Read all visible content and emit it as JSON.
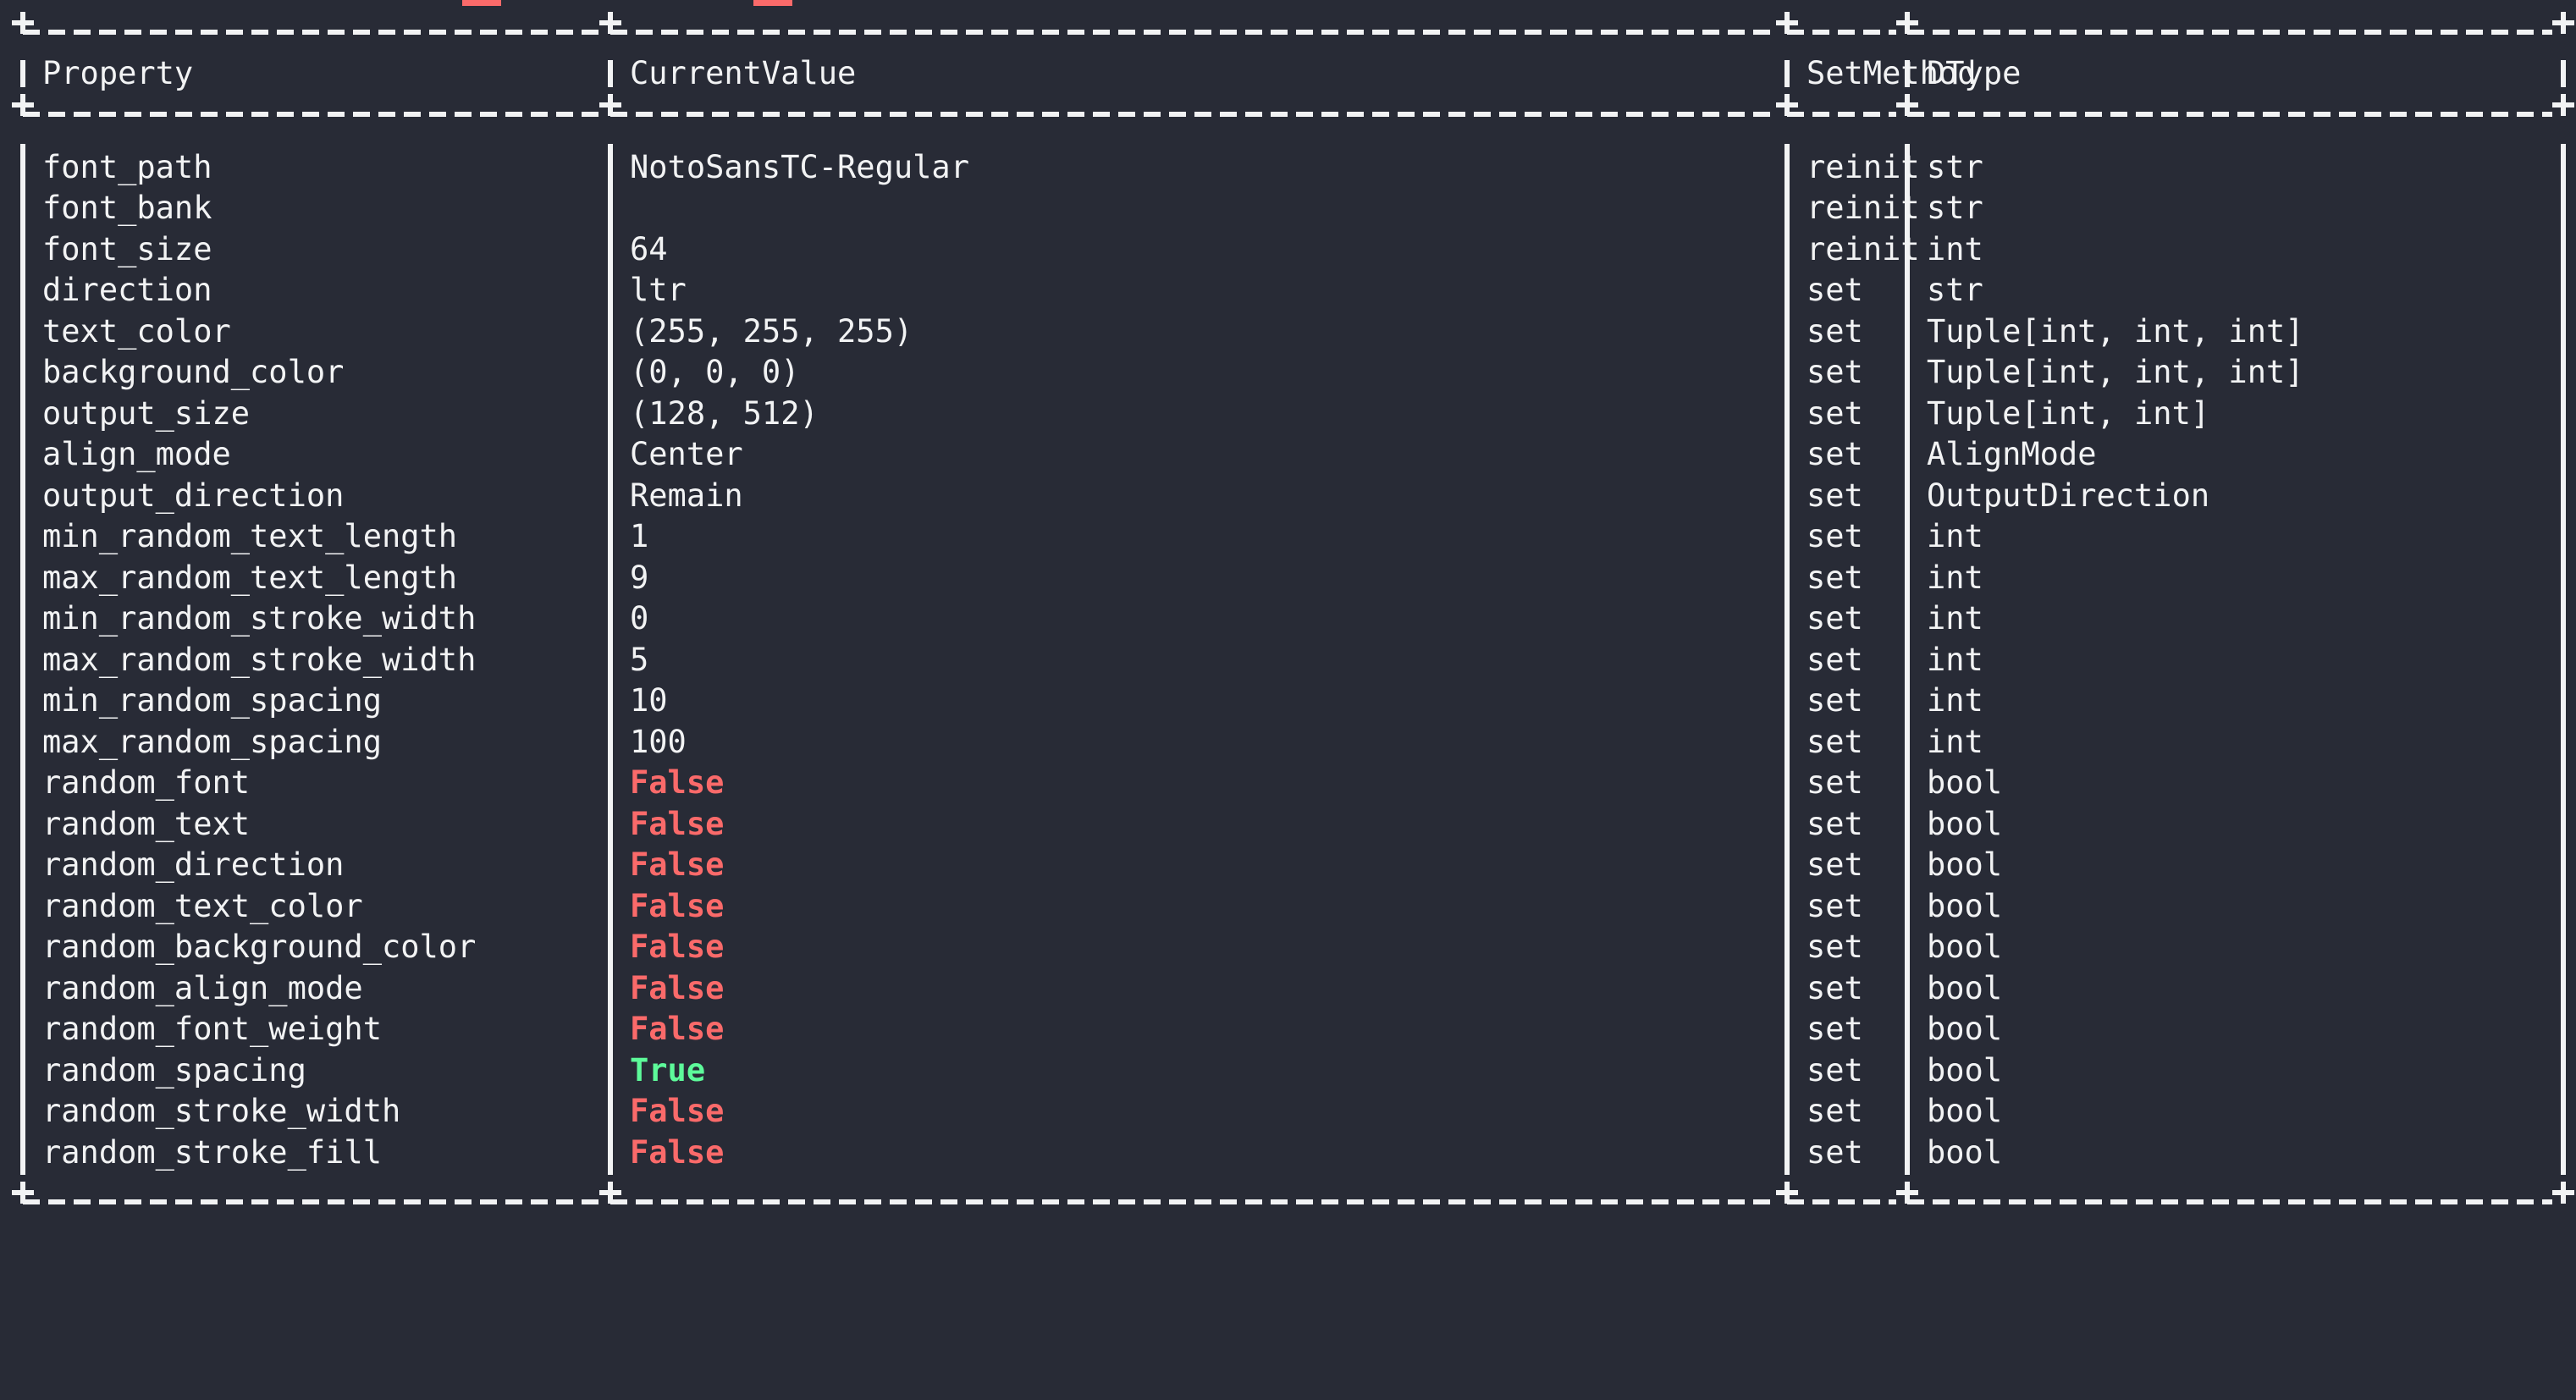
{
  "terminal": {
    "background_color": "#282b36",
    "foreground_color": "#f2f3f4",
    "true_color": "#5dfa9a",
    "false_color": "#fa6a6a"
  },
  "table": {
    "border_style": "ascii-plus-dash-pipe",
    "columns": [
      {
        "key": "property",
        "label": "Property"
      },
      {
        "key": "current_value",
        "label": "CurrentValue"
      },
      {
        "key": "set_method",
        "label": "SetMethod"
      },
      {
        "key": "dtype",
        "label": "DType"
      }
    ],
    "rows": [
      {
        "property": "font_path",
        "current_value": "NotoSansTC-Regular",
        "set_method": "reinit",
        "dtype": "str",
        "value_kind": "text"
      },
      {
        "property": "font_bank",
        "current_value": "",
        "set_method": "reinit",
        "dtype": "str",
        "value_kind": "text"
      },
      {
        "property": "font_size",
        "current_value": "64",
        "set_method": "reinit",
        "dtype": "int",
        "value_kind": "text"
      },
      {
        "property": "direction",
        "current_value": "ltr",
        "set_method": "set",
        "dtype": "str",
        "value_kind": "text"
      },
      {
        "property": "text_color",
        "current_value": "(255, 255, 255)",
        "set_method": "set",
        "dtype": "Tuple[int, int, int]",
        "value_kind": "text"
      },
      {
        "property": "background_color",
        "current_value": "(0, 0, 0)",
        "set_method": "set",
        "dtype": "Tuple[int, int, int]",
        "value_kind": "text"
      },
      {
        "property": "output_size",
        "current_value": "(128, 512)",
        "set_method": "set",
        "dtype": "Tuple[int, int]",
        "value_kind": "text"
      },
      {
        "property": "align_mode",
        "current_value": "Center",
        "set_method": "set",
        "dtype": "AlignMode",
        "value_kind": "text"
      },
      {
        "property": "output_direction",
        "current_value": "Remain",
        "set_method": "set",
        "dtype": "OutputDirection",
        "value_kind": "text"
      },
      {
        "property": "min_random_text_length",
        "current_value": "1",
        "set_method": "set",
        "dtype": "int",
        "value_kind": "text"
      },
      {
        "property": "max_random_text_length",
        "current_value": "9",
        "set_method": "set",
        "dtype": "int",
        "value_kind": "text"
      },
      {
        "property": "min_random_stroke_width",
        "current_value": "0",
        "set_method": "set",
        "dtype": "int",
        "value_kind": "text"
      },
      {
        "property": "max_random_stroke_width",
        "current_value": "5",
        "set_method": "set",
        "dtype": "int",
        "value_kind": "text"
      },
      {
        "property": "min_random_spacing",
        "current_value": "10",
        "set_method": "set",
        "dtype": "int",
        "value_kind": "text"
      },
      {
        "property": "max_random_spacing",
        "current_value": "100",
        "set_method": "set",
        "dtype": "int",
        "value_kind": "text"
      },
      {
        "property": "random_font",
        "current_value": "False",
        "set_method": "set",
        "dtype": "bool",
        "value_kind": "false"
      },
      {
        "property": "random_text",
        "current_value": "False",
        "set_method": "set",
        "dtype": "bool",
        "value_kind": "false"
      },
      {
        "property": "random_direction",
        "current_value": "False",
        "set_method": "set",
        "dtype": "bool",
        "value_kind": "false"
      },
      {
        "property": "random_text_color",
        "current_value": "False",
        "set_method": "set",
        "dtype": "bool",
        "value_kind": "false"
      },
      {
        "property": "random_background_color",
        "current_value": "False",
        "set_method": "set",
        "dtype": "bool",
        "value_kind": "false"
      },
      {
        "property": "random_align_mode",
        "current_value": "False",
        "set_method": "set",
        "dtype": "bool",
        "value_kind": "false"
      },
      {
        "property": "random_font_weight",
        "current_value": "False",
        "set_method": "set",
        "dtype": "bool",
        "value_kind": "false"
      },
      {
        "property": "random_spacing",
        "current_value": "True",
        "set_method": "set",
        "dtype": "bool",
        "value_kind": "true"
      },
      {
        "property": "random_stroke_width",
        "current_value": "False",
        "set_method": "set",
        "dtype": "bool",
        "value_kind": "false"
      },
      {
        "property": "random_stroke_fill",
        "current_value": "False",
        "set_method": "set",
        "dtype": "bool",
        "value_kind": "false"
      }
    ]
  }
}
